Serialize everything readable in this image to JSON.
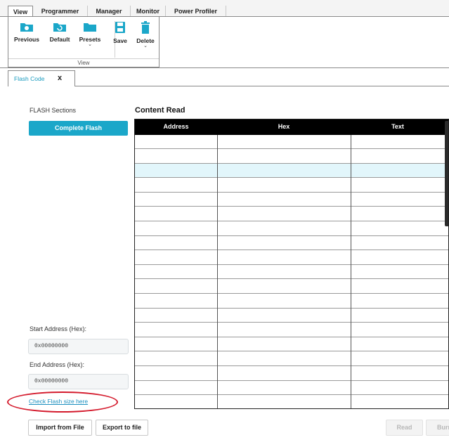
{
  "ribbon": {
    "tabs": [
      "View",
      "Programmer",
      "Manager",
      "Monitor",
      "Power Profiler"
    ],
    "active_tab": "View",
    "buttons": [
      {
        "label": "Previous",
        "icon": "folder-open-icon",
        "has_dropdown": false
      },
      {
        "label": "Default",
        "icon": "folder-refresh-icon",
        "has_dropdown": false
      },
      {
        "label": "Presets",
        "icon": "folder-icon",
        "has_dropdown": true
      },
      {
        "label": "Save",
        "icon": "save-icon",
        "has_dropdown": false
      },
      {
        "label": "Delete",
        "icon": "trash-icon",
        "has_dropdown": true
      }
    ],
    "group_label": "View",
    "accent_color": "#1ba7c9"
  },
  "doc_tab": {
    "label": "Flash Code",
    "close": "x"
  },
  "left_panel": {
    "sections_label": "FLASH Sections",
    "complete_flash_label": "Complete Flash",
    "start_address_label": "Start Address (Hex):",
    "start_address_value": "0x00000000",
    "end_address_label": "End Address (Hex):",
    "end_address_value": "0x00000000",
    "check_flash_link": "Check Flash size here",
    "annotation_color": "#d41a2c"
  },
  "table": {
    "title": "Content Read",
    "columns": [
      "Address",
      "Hex",
      "Text"
    ],
    "row_count": 19,
    "selected_row": 2,
    "rows": []
  },
  "footer": {
    "import_label": "Import from File",
    "export_label": "Export to file",
    "read_label": "Read",
    "burn_label": "Burn"
  }
}
